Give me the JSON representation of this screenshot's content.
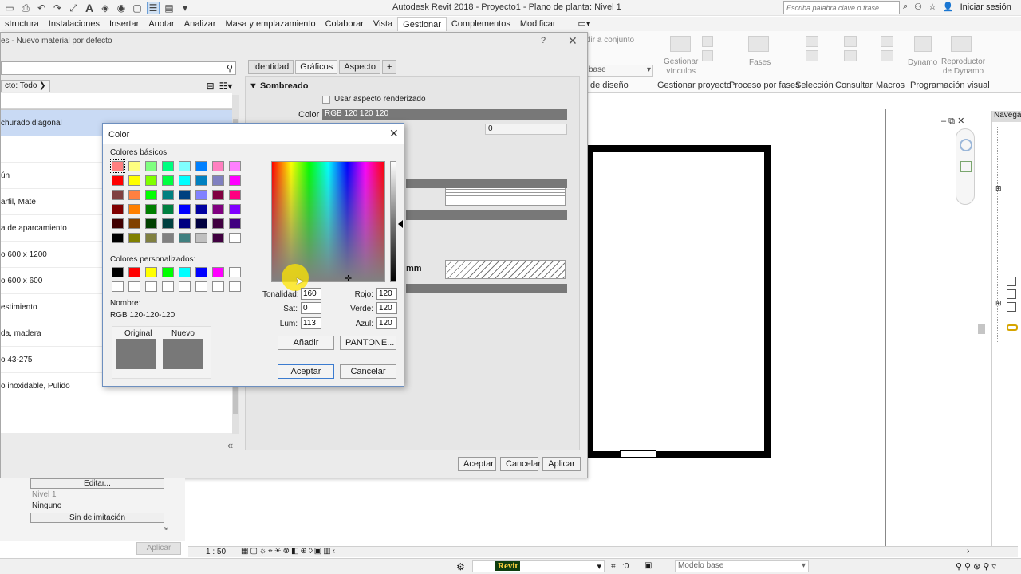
{
  "titlebar": {
    "app_title": "Autodesk Revit 2018 -     Proyecto1 - Plano de planta: Nivel 1",
    "search_placeholder": "Escriba palabra clave o frase",
    "user_label": "Iniciar sesión",
    "qat_icons": [
      "save-icon",
      "print-icon",
      "undo-icon",
      "redo-icon",
      "measure-icon",
      "text-icon"
    ]
  },
  "ribbon": {
    "tabs": [
      {
        "label": "structura",
        "active": false
      },
      {
        "label": "Instalaciones",
        "active": false
      },
      {
        "label": "Insertar",
        "active": false
      },
      {
        "label": "Anotar",
        "active": false
      },
      {
        "label": "Analizar",
        "active": false
      },
      {
        "label": "Masa y emplazamiento",
        "active": false
      },
      {
        "label": "Colaborar",
        "active": false
      },
      {
        "label": "Vista",
        "active": false
      },
      {
        "label": "Gestionar",
        "active": true
      },
      {
        "label": "Complementos",
        "active": false
      },
      {
        "label": "Modificar",
        "active": false
      }
    ],
    "buttons": {
      "add_set": "dir a conjunto",
      "base": "base",
      "gestionar_vinculos": "Gestionar\nvínculos",
      "fases": "Fases",
      "dynamo": "Dynamo",
      "reproductor": "Reproductor\nde Dynamo"
    },
    "groups": {
      "de_diseno": "de diseño",
      "gestionar_proyecto": "Gestionar proyecto",
      "proceso_por_fases": "Proceso por fases",
      "seleccion": "Selección",
      "consultar": "Consultar",
      "macros": "Macros",
      "programacion_visual": "Programación visual"
    }
  },
  "material_dialog": {
    "title": "es - Nuevo material por defecto",
    "filter_label": "cto: Todo",
    "materials": [
      {
        "name": "churado diagonal",
        "selected": true
      },
      {
        "name": "",
        "selected": false
      },
      {
        "name": "ún",
        "selected": false
      },
      {
        "name": "arfil, Mate",
        "selected": false
      },
      {
        "name": "a de aparcamiento",
        "selected": false
      },
      {
        "name": "o 600 x 1200",
        "selected": false
      },
      {
        "name": "o 600 x 600",
        "selected": false
      },
      {
        "name": "estimiento",
        "selected": false
      },
      {
        "name": "da, madera",
        "selected": false
      },
      {
        "name": "o 43-275",
        "selected": false
      },
      {
        "name": "o inoxidable, Pulido",
        "selected": false
      }
    ],
    "tabs": [
      {
        "label": "Identidad",
        "active": false
      },
      {
        "label": "Gráficos",
        "active": true
      },
      {
        "label": "Aspecto",
        "active": false
      },
      {
        "label": "+",
        "active": false
      }
    ],
    "section_shading": "Sombreado",
    "use_render_label": "Usar aspecto renderizado",
    "color_label": "Color",
    "color_value": "RGB 120 120 120",
    "transparency_value": "0",
    "mm_label": "mm",
    "buttons": {
      "accept": "Aceptar",
      "cancel": "Cancelar",
      "apply": "Aplicar"
    }
  },
  "color_dialog": {
    "title": "Color",
    "basic_label": "Colores básicos:",
    "basic_colors": [
      "#ff8080",
      "#ffff80",
      "#80ff80",
      "#00ff80",
      "#80ffff",
      "#0080ff",
      "#ff80c0",
      "#ff80ff",
      "#ff0000",
      "#ffff00",
      "#80ff00",
      "#00ff40",
      "#00ffff",
      "#0080c0",
      "#8080c0",
      "#ff00ff",
      "#804040",
      "#ff8040",
      "#00ff00",
      "#008080",
      "#004080",
      "#8080ff",
      "#800040",
      "#ff0080",
      "#800000",
      "#ff8000",
      "#008000",
      "#008040",
      "#0000ff",
      "#0000a0",
      "#800080",
      "#8000ff",
      "#400000",
      "#804000",
      "#004000",
      "#004040",
      "#000080",
      "#000040",
      "#400040",
      "#400080",
      "#000000",
      "#808000",
      "#808040",
      "#808080",
      "#408080",
      "#c0c0c0",
      "#400040",
      "#ffffff"
    ],
    "custom_label": "Colores personalizados:",
    "custom_colors": [
      "#000000",
      "#ff0000",
      "#ffff00",
      "#00ff00",
      "#00ffff",
      "#0000ff",
      "#ff00ff",
      "#ffffff",
      "#ffffff",
      "#ffffff",
      "#ffffff",
      "#ffffff",
      "#ffffff",
      "#ffffff",
      "#ffffff",
      "#ffffff"
    ],
    "name_label": "Nombre:",
    "name_value": "RGB 120-120-120",
    "original_label": "Original",
    "new_label": "Nuevo",
    "original_color": "#787878",
    "new_color": "#787878",
    "fields": {
      "hue_label": "Tonalidad:",
      "hue": "160",
      "sat_label": "Sat:",
      "sat": "0",
      "lum_label": "Lum:",
      "lum": "113",
      "red_label": "Rojo:",
      "red": "120",
      "green_label": "Verde:",
      "green": "120",
      "blue_label": "Azul:",
      "blue": "120"
    },
    "buttons": {
      "add": "Añadir",
      "pantone": "PANTONE...",
      "accept": "Aceptar",
      "cancel": "Cancelar"
    }
  },
  "lower_props": {
    "edit_label": "Editar...",
    "level_value": "Nivel 1",
    "none_value": "Ninguno",
    "no_limit_label": "Sin delimitación",
    "apply_label": "Aplicar"
  },
  "viewbar": {
    "scale": "1 : 50"
  },
  "statusbar": {
    "model_label": "Modelo base",
    "zero": ":0",
    "revit_badge": "Revit"
  },
  "navpanel": {
    "title": "Navegad"
  }
}
